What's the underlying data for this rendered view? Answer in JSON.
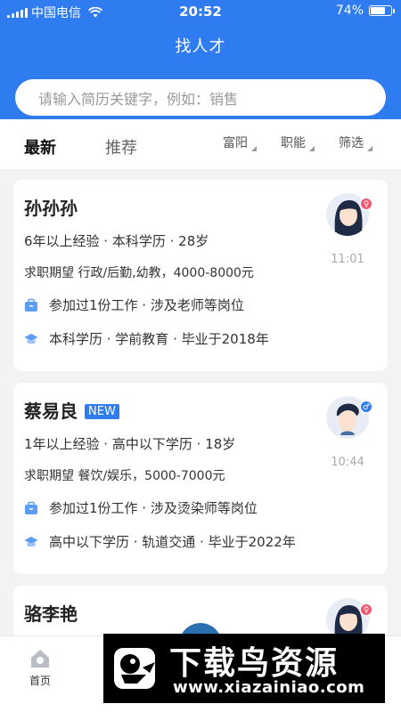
{
  "status_bar": {
    "carrier": "中国电信",
    "time": "20:52",
    "battery": "74%",
    "battery_level": 0.74
  },
  "header": {
    "title": "找人才"
  },
  "search": {
    "placeholder": "请输入简历关键字，例如：销售"
  },
  "tabs": {
    "latest": "最新",
    "recommend": "推荐"
  },
  "filters": {
    "location": "富阳",
    "function": "职能",
    "screen": "筛选"
  },
  "candidates": [
    {
      "name": "孙孙孙",
      "gender": "female",
      "gender_symbol": "♀",
      "gender_color": "#f0566e",
      "summary": "6年以上经验 · 本科学历 · 28岁",
      "expectation": "求职期望 行政/后勤,幼教，4000-8000元",
      "work": "参加过1份工作 · 涉及老师等岗位",
      "education": "本科学历 · 学前教育 · 毕业于2018年",
      "time": "11:01"
    },
    {
      "name": "蔡易良",
      "badge": "NEW",
      "gender": "male",
      "gender_symbol": "♂",
      "gender_color": "#2f7bf0",
      "summary": "1年以上经验 · 高中以下学历 · 18岁",
      "expectation": "求职期望 餐饮/娱乐，5000-7000元",
      "work": "参加过1份工作 · 涉及烫染师等岗位",
      "education": "高中以下学历 · 轨道交通 · 毕业于2022年",
      "time": "10:44"
    },
    {
      "name": "骆李艳",
      "gender": "female",
      "gender_symbol": "♀",
      "gender_color": "#f0566e"
    }
  ],
  "tabbar": {
    "home": "首页"
  },
  "watermark": {
    "title": "下载鸟资源",
    "url": "www.xiazainiao.com"
  },
  "colors": {
    "primary": "#2f7bf0",
    "background": "#f2f3f5",
    "icon_blue": "#5b9cf5"
  }
}
